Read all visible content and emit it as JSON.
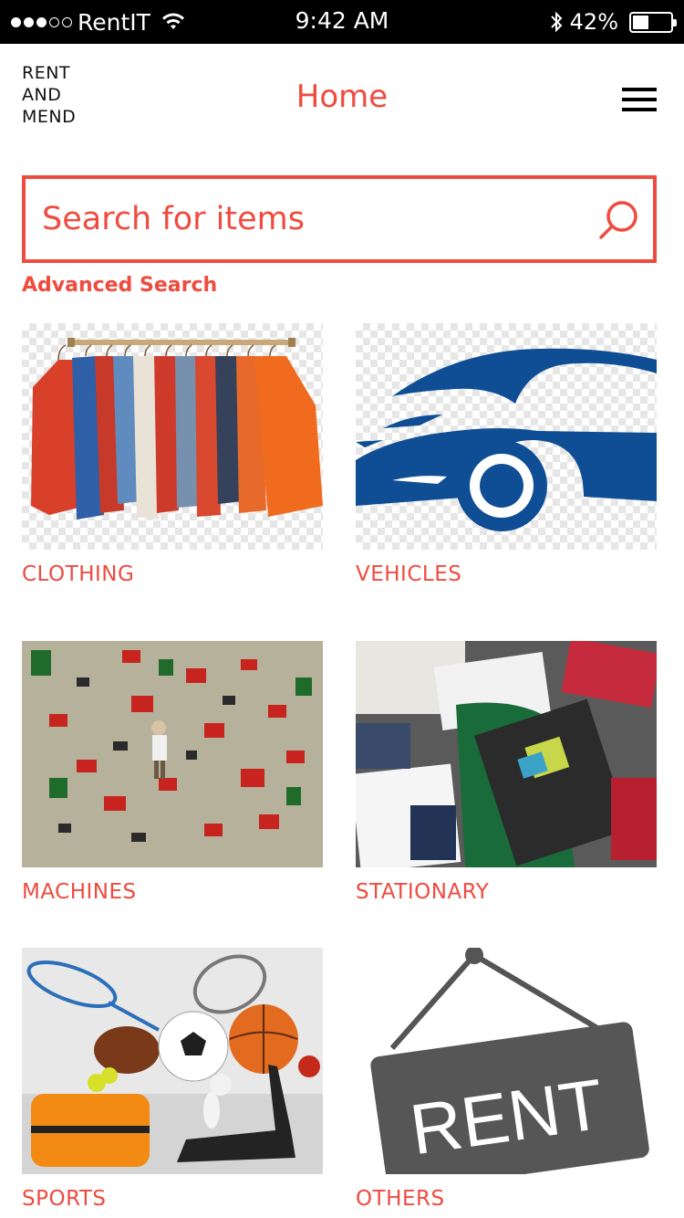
{
  "status_bar": {
    "carrier": "RentIT",
    "time": "9:42 AM",
    "battery": "42%",
    "battery_level": 0.42
  },
  "header": {
    "brand_lines": [
      "RENT",
      "AND",
      "MEND"
    ],
    "title": "Home"
  },
  "search": {
    "placeholder": "Search for items",
    "advanced_label": "Advanced Search"
  },
  "categories": [
    {
      "label": "CLOTHING"
    },
    {
      "label": "VEHICLES"
    },
    {
      "label": "MACHINES"
    },
    {
      "label": "STATIONARY"
    },
    {
      "label": "SPORTS"
    },
    {
      "label": "OTHERS"
    }
  ],
  "others_sign_text": "RENT",
  "colors": {
    "accent": "#ef4b3f",
    "status_bar_bg": "#000000",
    "vehicle_blue": "#0f4e94"
  }
}
